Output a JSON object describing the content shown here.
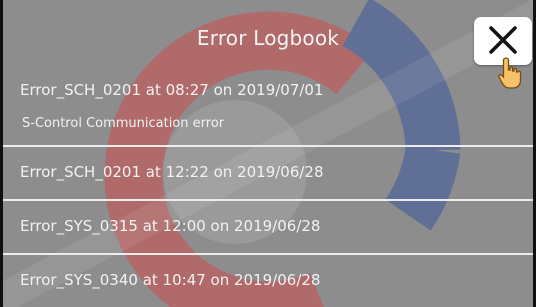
{
  "dialog": {
    "title": "Error Logbook",
    "close_icon": "close-x-icon",
    "cursor_icon": "hand-pointer-icon"
  },
  "entries": [
    {
      "title": "Error_SCH_0201 at 08:27 on 2019/07/01",
      "description": "S-Control Communication error"
    },
    {
      "title": "Error_SCH_0201 at 12:22 on 2019/06/28"
    },
    {
      "title": "Error_SYS_0315 at 12:00 on 2019/06/28"
    },
    {
      "title": "Error_SYS_0340 at 10:47 on 2019/06/28"
    }
  ],
  "colors": {
    "backdrop": "#8d8d8d",
    "watermark_red": "#b06a6a",
    "watermark_blue": "#5f6f96",
    "divider": "#ececec"
  }
}
